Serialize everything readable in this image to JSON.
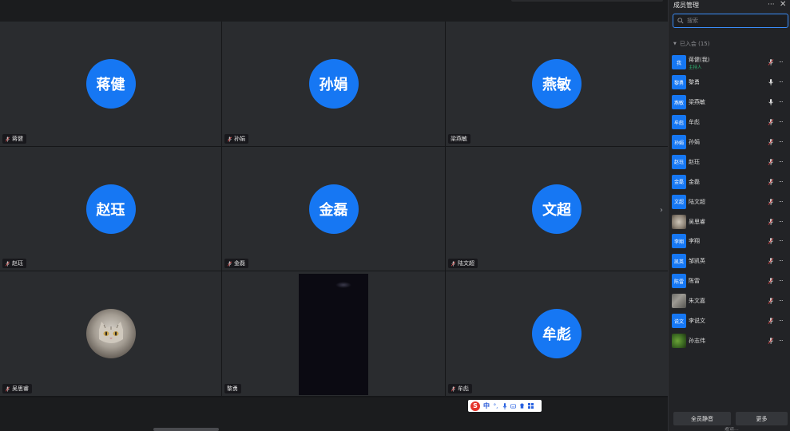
{
  "colors": {
    "accent": "#1677f3",
    "host": "#2eb872",
    "tile_bg": "#2a2c2f",
    "panel_bg": "#222326"
  },
  "grid": {
    "tiles": [
      {
        "avatar_text": "蒋健",
        "name": "蒋健",
        "muted_icon": true,
        "type": "avatar"
      },
      {
        "avatar_text": "孙娟",
        "name": "孙娟",
        "muted_icon": true,
        "type": "avatar"
      },
      {
        "avatar_text": "燕敏",
        "name": "梁燕敏",
        "muted_icon": false,
        "type": "avatar"
      },
      {
        "avatar_text": "赵珏",
        "name": "赵珏",
        "muted_icon": true,
        "type": "avatar"
      },
      {
        "avatar_text": "金磊",
        "name": "金磊",
        "muted_icon": true,
        "type": "avatar"
      },
      {
        "avatar_text": "文超",
        "name": "陆文超",
        "muted_icon": true,
        "type": "avatar"
      },
      {
        "avatar_text": "",
        "name": "吴思睿",
        "muted_icon": true,
        "type": "photo"
      },
      {
        "avatar_text": "",
        "name": "黎勇",
        "muted_icon": false,
        "type": "video"
      },
      {
        "avatar_text": "牟彪",
        "name": "牟彪",
        "muted_icon": true,
        "type": "avatar"
      }
    ]
  },
  "ime": {
    "logo": "S",
    "mode": "中",
    "icons": [
      "punct-icon",
      "mic-icon",
      "keyboard-icon",
      "skin-icon",
      "grid-icon"
    ]
  },
  "panel": {
    "title": "成员管理",
    "more_label": "···",
    "close_label": "✕",
    "search_placeholder": "搜索",
    "section_label": "已入会 (15)",
    "members": [
      {
        "avatar_text": "我",
        "name": "蒋健(我)",
        "role": "主持人",
        "mic": "muted"
      },
      {
        "avatar_text": "黎勇",
        "name": "黎勇",
        "role": "",
        "mic": "on"
      },
      {
        "avatar_text": "燕敏",
        "name": "梁燕敏",
        "role": "",
        "mic": "on"
      },
      {
        "avatar_text": "牟彪",
        "name": "牟彪",
        "role": "",
        "mic": "muted"
      },
      {
        "avatar_text": "孙娟",
        "name": "孙娟",
        "role": "",
        "mic": "muted"
      },
      {
        "avatar_text": "赵珏",
        "name": "赵珏",
        "role": "",
        "mic": "muted"
      },
      {
        "avatar_text": "金磊",
        "name": "金磊",
        "role": "",
        "mic": "muted"
      },
      {
        "avatar_text": "文超",
        "name": "陆文超",
        "role": "",
        "mic": "muted"
      },
      {
        "avatar_text": "",
        "avatar_image": "cat",
        "name": "吴思睿",
        "role": "",
        "mic": "muted"
      },
      {
        "avatar_text": "李翔",
        "name": "李翔",
        "role": "",
        "mic": "muted"
      },
      {
        "avatar_text": "凯英",
        "name": "邹凯英",
        "role": "",
        "mic": "muted"
      },
      {
        "avatar_text": "陈雷",
        "name": "陈雷",
        "role": "",
        "mic": "muted"
      },
      {
        "avatar_text": "",
        "avatar_image": "gray",
        "name": "朱文嘉",
        "role": "",
        "mic": "muted"
      },
      {
        "avatar_text": "说文",
        "name": "李说文",
        "role": "",
        "mic": "muted"
      },
      {
        "avatar_text": "",
        "avatar_image": "leaf",
        "name": "孙志伟",
        "role": "",
        "mic": "muted"
      }
    ],
    "mute_all_label": "全员静音",
    "more_button_label": "更多",
    "footer_text": "邀请..."
  }
}
